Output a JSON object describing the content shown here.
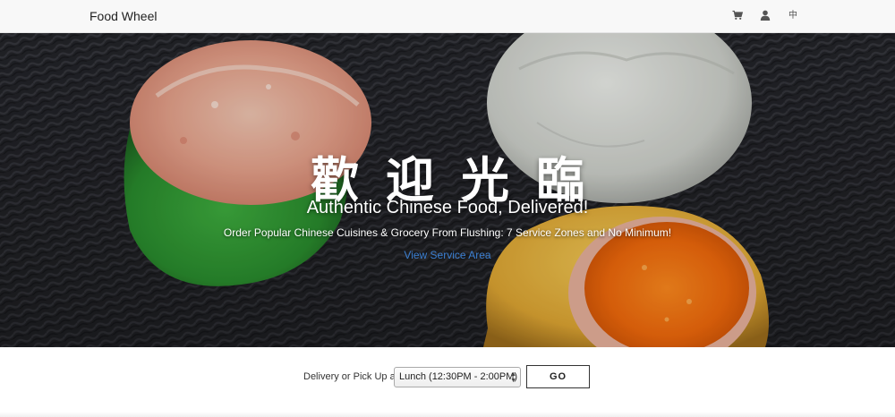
{
  "navbar": {
    "brand": "Food Wheel",
    "cart_icon": "cart-icon",
    "user_icon": "user-icon",
    "language_toggle": "中"
  },
  "hero": {
    "calligraphy": "歡迎光臨",
    "title": "Authentic Chinese Food, Delivered!",
    "subtitle": "Order Popular Chinese Cuisines & Grocery From Flushing: 7 Service Zones and No Minimum!",
    "link": "View Service Area"
  },
  "order": {
    "label": "Delivery or Pick Up at",
    "selected_time": "Lunch (12:30PM - 2:00PM)",
    "go_label": "GO"
  },
  "colors": {
    "link": "#3b7fd1",
    "navbar_bg": "#f8f8f8"
  }
}
